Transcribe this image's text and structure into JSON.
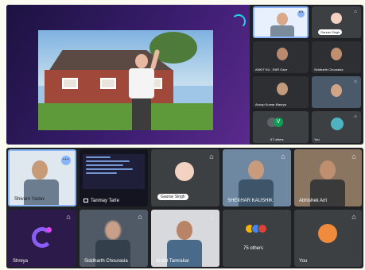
{
  "top_tiles": [
    {
      "name": "",
      "mic": "",
      "bg": "#e8f0fe"
    },
    {
      "name": "Gaurav Singh",
      "mic": "⌂",
      "bg": "#3c4043"
    },
    {
      "name": "ANKIT KU...RAR Gaur",
      "mic": "",
      "bg": "#2d2f33"
    },
    {
      "name": "Siddharth Chourasia",
      "mic": "",
      "bg": "#2d2f33"
    },
    {
      "name": "Anoop Kumar Maurya",
      "mic": "",
      "bg": "#2d2f33"
    },
    {
      "name": "",
      "mic": "⌂",
      "bg": "#4a5a6a"
    },
    {
      "name": "67 others",
      "mic": "",
      "bg": "#3c4043"
    },
    {
      "name": "You",
      "mic": "⌂",
      "bg": "#3c4043"
    }
  ],
  "bottom_tiles": [
    {
      "name": "Shivam Yadav",
      "mic": "",
      "more": "···"
    },
    {
      "name": "Tanmay Tarte",
      "mic": "",
      "more": ""
    },
    {
      "name": "Gaurav Singh",
      "mic": "⌂",
      "more": ""
    },
    {
      "name": "SHEKHAR KAUSHIK",
      "mic": "⌂",
      "more": ""
    },
    {
      "name": "Abhishek Arri",
      "mic": "⌂",
      "more": ""
    },
    {
      "name": "Shreya",
      "mic": "⌂",
      "more": ""
    },
    {
      "name": "Siddharth Chourasia",
      "mic": "⌂",
      "more": ""
    },
    {
      "name": "Archit Tamrakar",
      "mic": "⌂",
      "more": ""
    },
    {
      "name": "75 others",
      "mic": "",
      "more": ""
    },
    {
      "name": "You",
      "mic": "⌂",
      "more": ""
    }
  ],
  "colors": {
    "accent": "#8ab4f8",
    "active_border": "#8ab4f8",
    "tile_bg": "#3c4043",
    "panel_bg": "#202124"
  },
  "icons": {
    "mic_off": "mic-off-icon",
    "more": "more-options-icon"
  }
}
